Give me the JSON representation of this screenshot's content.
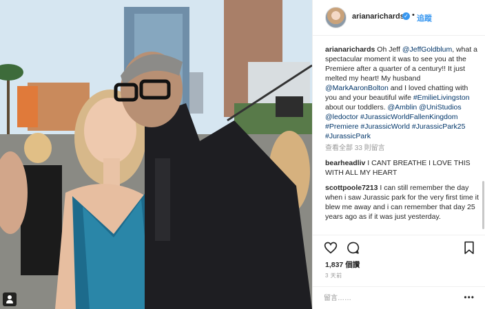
{
  "header": {
    "username": "arianarichards",
    "separator": "•",
    "follow_label": "追蹤"
  },
  "caption": {
    "username": "arianarichards",
    "parts": [
      {
        "text": "Oh Jeff ",
        "link": false
      },
      {
        "text": "@JeffGoldblum",
        "link": true
      },
      {
        "text": ", what a spectacular moment it was to see you at the Premiere after a quarter of a century!! It just melted my heart! My husband ",
        "link": false
      },
      {
        "text": "@MarkAaronBolton",
        "link": true
      },
      {
        "text": " and I loved chatting with you and your beautiful wife ",
        "link": false
      },
      {
        "text": "#EmilieLivingston",
        "link": true
      },
      {
        "text": " about our toddlers. ",
        "link": false
      },
      {
        "text": "@Amblin",
        "link": true
      },
      {
        "text": " ",
        "link": false
      },
      {
        "text": "@UniStudios",
        "link": true
      },
      {
        "text": " ",
        "link": false
      },
      {
        "text": "@ledoctor",
        "link": true
      },
      {
        "text": " ",
        "link": false
      },
      {
        "text": "#JurassicWorldFallenKingdom",
        "link": true
      },
      {
        "text": " ",
        "link": false
      },
      {
        "text": "#Premiere",
        "link": true
      },
      {
        "text": " ",
        "link": false
      },
      {
        "text": "#JurassicWorld",
        "link": true
      },
      {
        "text": " ",
        "link": false
      },
      {
        "text": "#JurassicPark25",
        "link": true
      },
      {
        "text": " ",
        "link": false
      },
      {
        "text": "#JurassicPark",
        "link": true
      }
    ]
  },
  "view_all_comments": "查看全部 33 則留言",
  "comments": [
    {
      "username": "bearheadliv",
      "text": "I CANT BREATHE I LOVE THIS WITH ALL MY HEART"
    },
    {
      "username": "scottpoole7213",
      "text": "I can still remember the day when i saw Jurassic park for the very first time it blew me away and i can remember that day 25 years ago as if it was just yesterday."
    }
  ],
  "likes": "1,837 個讚",
  "time_ago": "3 天前",
  "add_comment_placeholder": "留言……",
  "more_label": "•••",
  "icons": {
    "verified": "verified-badge-icon",
    "like": "heart-icon",
    "comment": "comment-bubble-icon",
    "save": "bookmark-icon",
    "tag": "user-tag-icon",
    "more": "more-dots-icon"
  },
  "colors": {
    "link": "#003569",
    "accent": "#3897f0",
    "muted": "#999999",
    "border": "#efefef"
  }
}
